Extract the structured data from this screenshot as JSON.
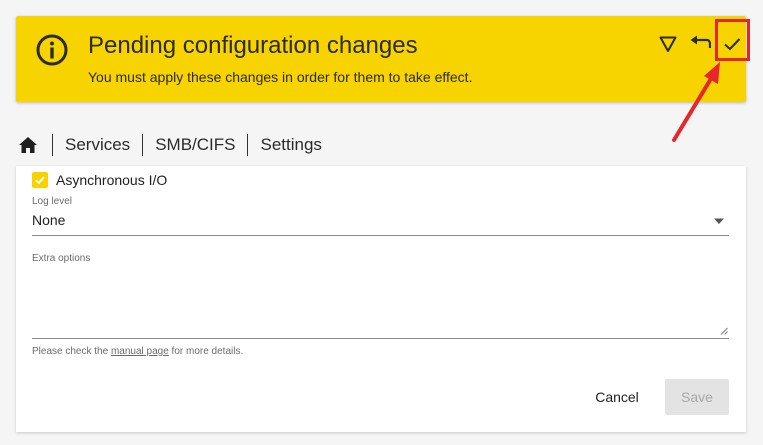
{
  "banner": {
    "title": "Pending configuration changes",
    "message": "You must apply these changes in order for them to take effect.",
    "background_color": "#f7d300",
    "icons": {
      "info": "info-circle-icon",
      "filter": "filter-triangle-icon",
      "undo": "undo-icon",
      "apply": "check-icon"
    }
  },
  "annotation": {
    "color": "#e5262a",
    "highlight": "apply-changes-button"
  },
  "breadcrumb": {
    "home_icon": "home-icon",
    "items": [
      "Services",
      "SMB/CIFS",
      "Settings"
    ]
  },
  "form": {
    "async_io": {
      "label": "Asynchronous I/O",
      "checked": true
    },
    "log_level": {
      "label": "Log level",
      "value": "None"
    },
    "extra_options": {
      "label": "Extra options",
      "value": ""
    },
    "hint": {
      "prefix": "Please check the ",
      "link": "manual page",
      "suffix": " for more details."
    },
    "cancel_label": "Cancel",
    "save_label": "Save"
  }
}
